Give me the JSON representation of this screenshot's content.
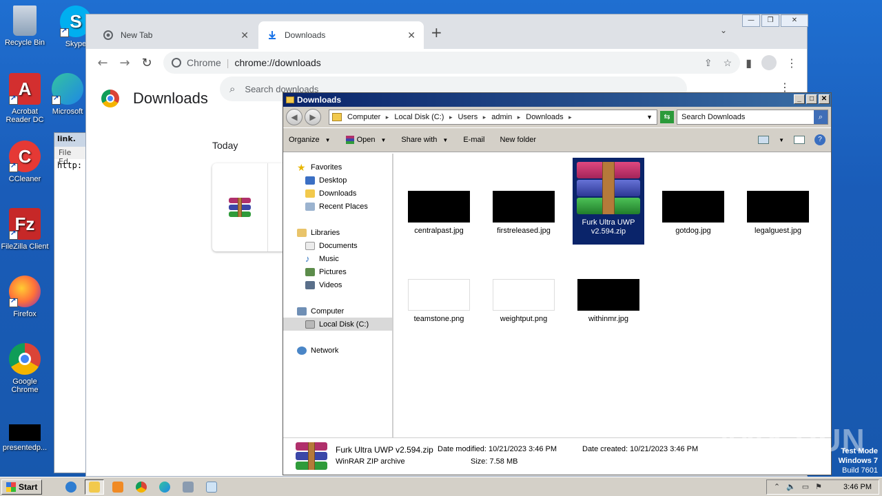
{
  "desktop": {
    "icons": [
      {
        "label": "Recycle Bin",
        "icon": "recycle-bin-icon",
        "color": "#8aa0b8"
      },
      {
        "label": "Skype",
        "icon": "skype-icon",
        "color": "#00aff0"
      },
      {
        "label": "Acrobat Reader DC",
        "icon": "acrobat-icon",
        "color": "#d32f2f"
      },
      {
        "label": "Microsoft",
        "icon": "edge-icon",
        "color": "#1e88e5"
      },
      {
        "label": "CCleaner",
        "icon": "ccleaner-icon",
        "color": "#e53935"
      },
      {
        "label": "FileZilla Client",
        "icon": "filezilla-icon",
        "color": "#c62828"
      },
      {
        "label": "Firefox",
        "icon": "firefox-icon",
        "color": "#ff7139"
      },
      {
        "label": "Google Chrome",
        "icon": "chrome-icon",
        "color": "#4285f4"
      },
      {
        "label": "presentedp...",
        "icon": "black-thumbnail-icon",
        "color": "#000000"
      }
    ]
  },
  "notepad": {
    "title": "link.",
    "menu": "File  Ed",
    "text": "http:"
  },
  "chrome": {
    "tabs": [
      {
        "title": "New Tab",
        "icon": "chrome-tab-icon"
      },
      {
        "title": "Downloads",
        "icon": "download-icon"
      }
    ],
    "omnibox": {
      "site": "Chrome",
      "url": "chrome://downloads"
    },
    "page_title": "Downloads",
    "search_placeholder": "Search downloads",
    "section": "Today"
  },
  "explorer": {
    "title": "Downloads",
    "breadcrumbs": [
      "Computer",
      "Local Disk (C:)",
      "Users",
      "admin",
      "Downloads"
    ],
    "search_placeholder": "Search Downloads",
    "commands": [
      "Organize",
      "Open",
      "Share with",
      "E-mail",
      "New folder"
    ],
    "nav": {
      "favorites": "Favorites",
      "favorites_items": [
        "Desktop",
        "Downloads",
        "Recent Places"
      ],
      "libraries": "Libraries",
      "libraries_items": [
        "Documents",
        "Music",
        "Pictures",
        "Videos"
      ],
      "computer": "Computer",
      "computer_items": [
        "Local Disk (C:)"
      ],
      "network": "Network"
    },
    "files": [
      {
        "name": "centralpast.jpg",
        "thumb": "black"
      },
      {
        "name": "firstreleased.jpg",
        "thumb": "black"
      },
      {
        "name": "Furk Ultra UWP v2.594.zip",
        "thumb": "winrar"
      },
      {
        "name": "gotdog.jpg",
        "thumb": "black"
      },
      {
        "name": "legalguest.jpg",
        "thumb": "black"
      },
      {
        "name": "teamstone.png",
        "thumb": "white"
      },
      {
        "name": "weightput.png",
        "thumb": "white"
      },
      {
        "name": "withinmr.jpg",
        "thumb": "black"
      }
    ],
    "status": {
      "name": "Furk Ultra UWP v2.594.zip",
      "type": "WinRAR ZIP archive",
      "modified": "Date modified: 10/21/2023 3:46 PM",
      "size": "Size: 7.58 MB",
      "created": "Date created: 10/21/2023 3:46 PM"
    }
  },
  "watermark": "ANY RUN",
  "testmode": {
    "line1": "Test Mode",
    "line2": "Windows 7",
    "line3": "Build 7601"
  },
  "taskbar": {
    "start": "Start",
    "clock": "3:46 PM"
  }
}
